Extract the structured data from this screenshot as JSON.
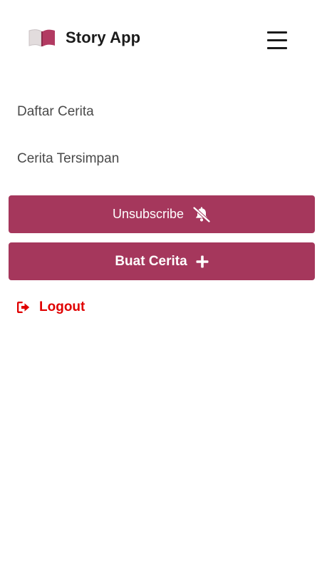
{
  "header": {
    "brand_title": "Story App",
    "brand_icon": "open-book-icon",
    "menu_icon": "hamburger-menu-icon"
  },
  "nav": {
    "items": [
      {
        "label": "Daftar Cerita"
      },
      {
        "label": "Cerita Tersimpan"
      }
    ]
  },
  "actions": {
    "unsubscribe": {
      "label": "Unsubscribe",
      "icon": "bell-slash-icon"
    },
    "create_story": {
      "label": "Buat Cerita",
      "icon": "plus-icon"
    }
  },
  "logout": {
    "label": "Logout",
    "icon": "sign-out-icon"
  },
  "colors": {
    "accent": "#a5375c",
    "logout": "#e00000",
    "brand_text": "#1b1b1b",
    "nav_text": "#4a4a4a"
  }
}
